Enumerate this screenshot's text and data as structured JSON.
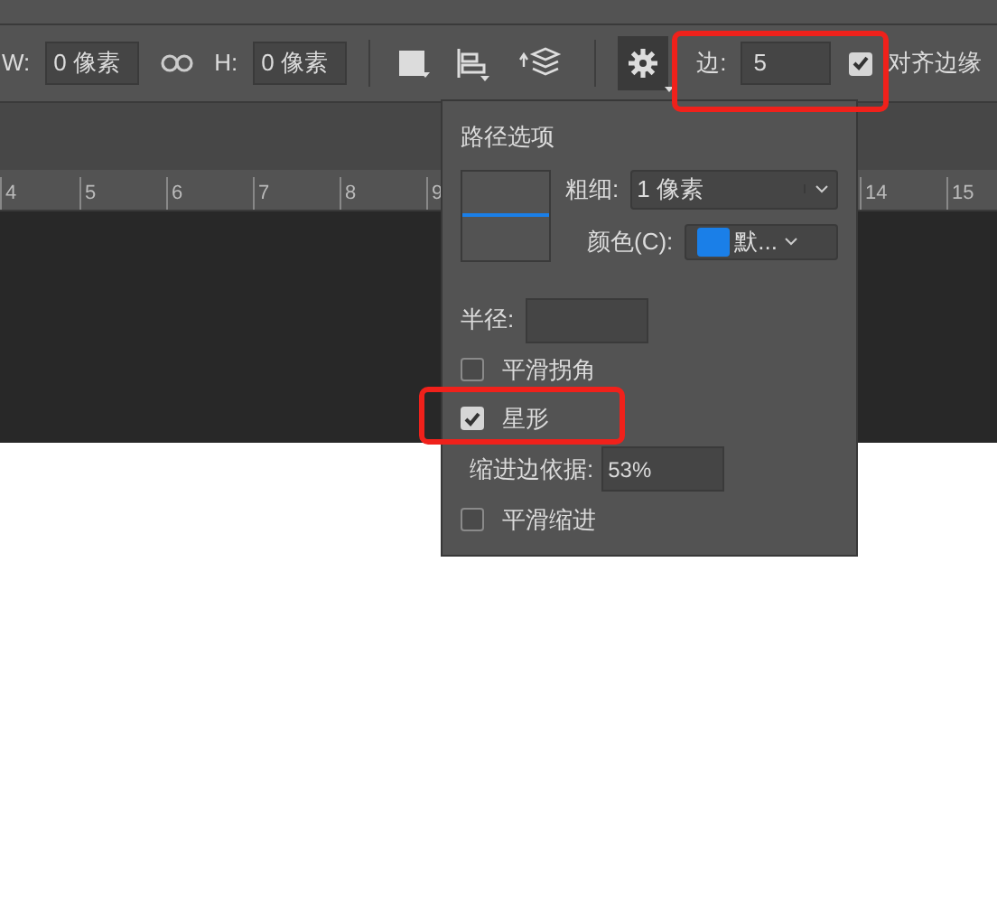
{
  "toolbar": {
    "w_label": "W:",
    "w_value": "0 像素",
    "h_label": "H:",
    "h_value": "0 像素",
    "sides_label": "边:",
    "sides_value": "5",
    "align_edges": {
      "label": "对齐边缘",
      "checked": true
    }
  },
  "ruler": [
    "4",
    "5",
    "6",
    "7",
    "8",
    "9",
    "14",
    "15"
  ],
  "path_options": {
    "title": "路径选项",
    "thickness_label": "粗细:",
    "thickness_value": "1 像素",
    "color_label": "颜色(C):",
    "color_value": "默...",
    "color": "#1a7fe8",
    "radius_label": "半径:",
    "options": [
      {
        "kind": "checkbox",
        "label": "平滑拐角",
        "checked": false
      },
      {
        "kind": "checkbox",
        "label": "星形",
        "checked": true
      },
      {
        "kind": "field",
        "label": "缩进边依据:",
        "value": "53%"
      },
      {
        "kind": "checkbox",
        "label": "平滑缩进",
        "checked": false
      }
    ]
  }
}
